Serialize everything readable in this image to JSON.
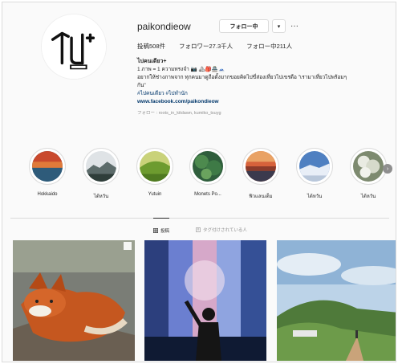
{
  "profile": {
    "username": "paikondieow",
    "follow_label": "フォロー中",
    "dropdown_label": "▾",
    "more_label": "···",
    "stats": {
      "posts": "投稿508件",
      "followers": "フォロワー27.3千人",
      "following": "フォロー中211人"
    },
    "bio": {
      "name": "ไปคนเดียว+",
      "line1": "1 ภาพ = 1 ความทรงจำ 📷 🏔🎒🏯🗻",
      "line2": "อยากให้ช่างภาพจาก ทุกคนมาดูถือดั้งมากขอยคิดไปขี่ส่องเที่ยวไปเขรดือ \"เรามาเที่ยวไปพร้อมๆ",
      "line3": "กัน\"",
      "tags": "#ไปคนเดียว #ไปทำนัก",
      "link": "www.facebook.com/paikondieow",
      "followed_by": "フォロー : roots_in_kitdawn, kumiko_tsuyg"
    }
  },
  "highlights": [
    {
      "label": "Hokkaido",
      "icon": "lake-icon"
    },
    {
      "label": "ไต้หวัน",
      "icon": "mountain-icon"
    },
    {
      "label": "Yutuin",
      "icon": "hill-icon"
    },
    {
      "label": "Monets Po...",
      "icon": "forest-icon"
    },
    {
      "label": "ฟิวแลนเด็ม",
      "icon": "sunset-icon"
    },
    {
      "label": "ไต้หวัน",
      "icon": "snow-icon"
    },
    {
      "label": "ไต้หวัน",
      "icon": "flower-icon"
    }
  ],
  "tabs": {
    "posts": "投稿",
    "tagged": "タグ付けされている人"
  },
  "posts": [
    {
      "subject": "fox"
    },
    {
      "subject": "light-wall"
    },
    {
      "subject": "mountain-trail"
    }
  ],
  "colors": {
    "link": "#00376b",
    "border": "#dbdbdb",
    "muted": "#8e8e8e",
    "text": "#262626"
  }
}
